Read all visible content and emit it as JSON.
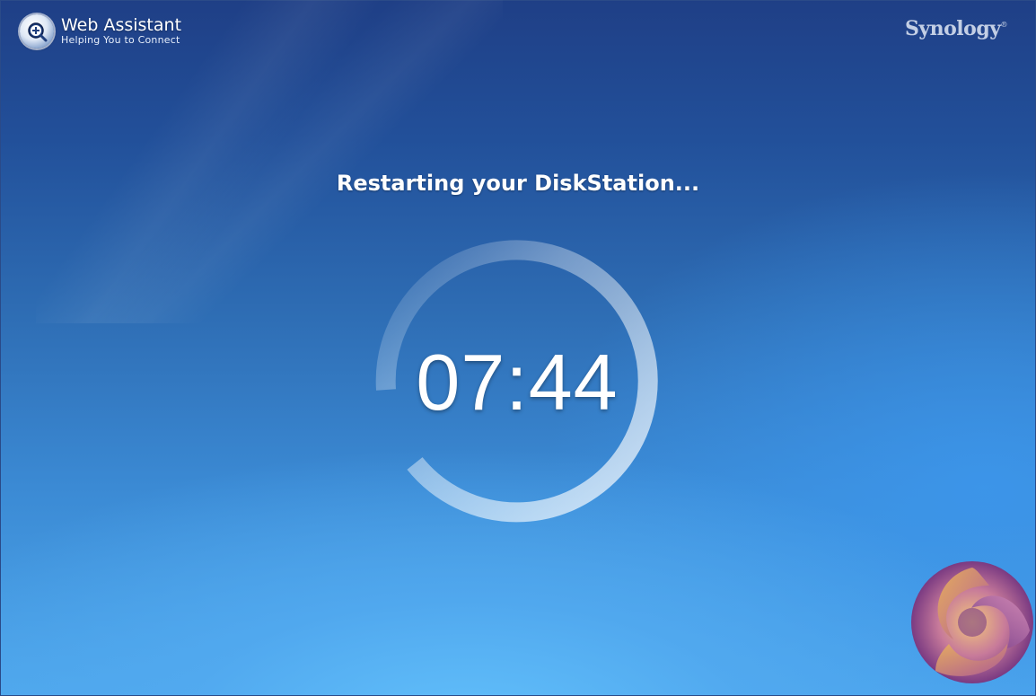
{
  "header": {
    "app_title": "Web Assistant",
    "app_subtitle": "Helping You to Connect",
    "brand_logo_icon": "magnifier-plus-icon",
    "vendor_logo": "Synology",
    "vendor_logo_mark": "®"
  },
  "main": {
    "status_text": "Restarting your DiskStation...",
    "countdown": "07:44",
    "countdown_ring_icon": "progress-ring"
  },
  "decoration": {
    "emblem_icon": "synology-emblem-icon"
  },
  "colors": {
    "background_top": "#1f3f86",
    "background_bottom": "#4ea7ec",
    "text": "#ffffff",
    "ring": "#cfe3f6"
  }
}
